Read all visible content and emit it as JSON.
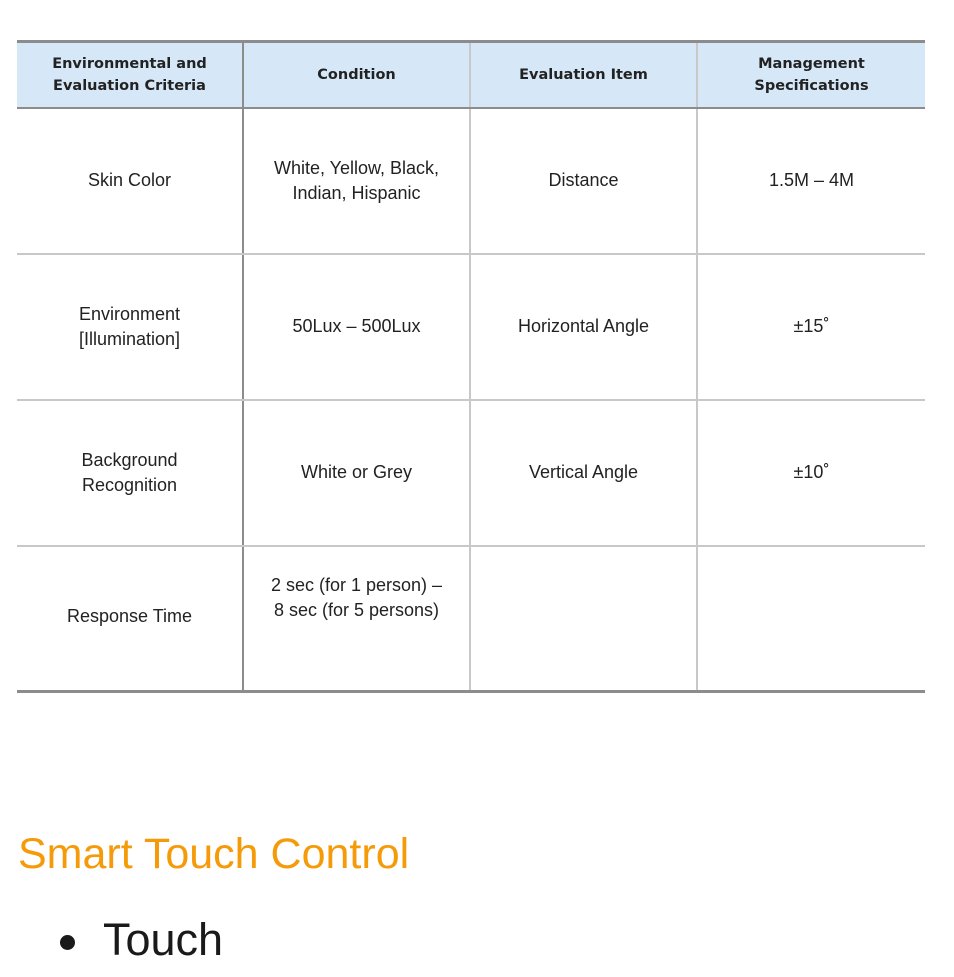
{
  "table": {
    "headers": [
      "Environmental and\nEvaluation Criteria",
      "Condition",
      "Evaluation Item",
      "Management\nSpecifications"
    ],
    "rows": [
      [
        "Skin Color",
        "White, Yellow, Black,\nIndian, Hispanic",
        "Distance",
        "1.5M – 4M"
      ],
      [
        "Environment\n[Illumination]",
        "50Lux – 500Lux",
        "Horizontal Angle",
        "±15˚"
      ],
      [
        "Background\nRecognition",
        "White or Grey",
        "Vertical Angle",
        "±10˚"
      ],
      [
        "Response Time",
        "2 sec (for 1 person) –\n8 sec (for 5 persons)",
        "",
        ""
      ]
    ]
  },
  "section": {
    "title": "Smart Touch Control",
    "title_color": "#f59b0a",
    "bullets": [
      "Touch"
    ]
  },
  "colors": {
    "header_background": "#d6e8f8",
    "strong_border": "#8c8c8c",
    "light_border": "#c8c8c8"
  }
}
